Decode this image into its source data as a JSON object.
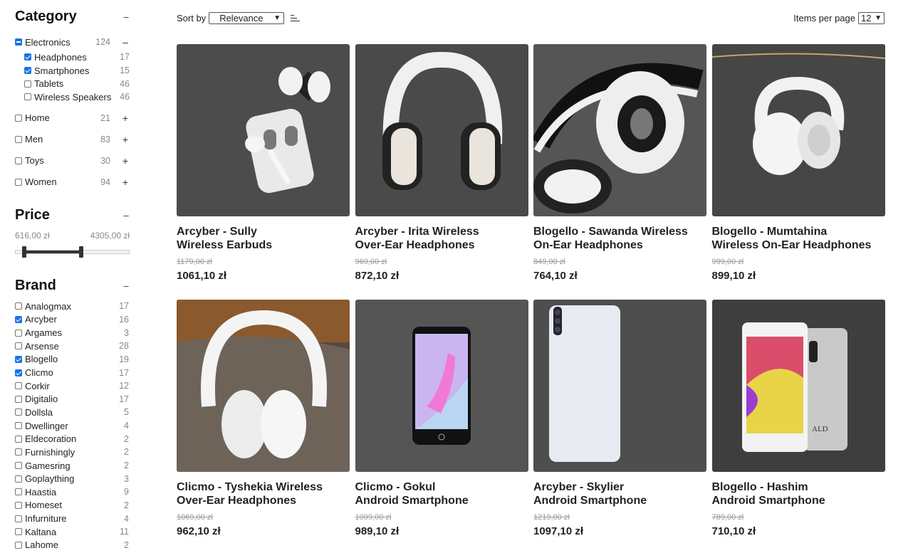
{
  "category": {
    "title": "Category",
    "collapse": "–",
    "parent": {
      "label": "Electronics",
      "count": "124",
      "toggle": "–"
    },
    "children": [
      {
        "label": "Headphones",
        "count": "17",
        "checked": true
      },
      {
        "label": "Smartphones",
        "count": "15",
        "checked": true
      },
      {
        "label": "Tablets",
        "count": "46",
        "checked": false
      },
      {
        "label": "Wireless Speakers",
        "count": "46",
        "checked": false
      }
    ],
    "others": [
      {
        "label": "Home",
        "count": "21",
        "toggle": "+"
      },
      {
        "label": "Men",
        "count": "83",
        "toggle": "+"
      },
      {
        "label": "Toys",
        "count": "30",
        "toggle": "+"
      },
      {
        "label": "Women",
        "count": "94",
        "toggle": "+"
      }
    ]
  },
  "price": {
    "title": "Price",
    "collapse": "–",
    "min_label": "616,00 zł",
    "max_label": "4305,00 zł"
  },
  "brand": {
    "title": "Brand",
    "collapse": "–",
    "items": [
      {
        "label": "Analogmax",
        "count": "17",
        "checked": false
      },
      {
        "label": "Arcyber",
        "count": "16",
        "checked": true
      },
      {
        "label": "Argames",
        "count": "3",
        "checked": false
      },
      {
        "label": "Arsense",
        "count": "28",
        "checked": false
      },
      {
        "label": "Blogello",
        "count": "19",
        "checked": true
      },
      {
        "label": "Clicmo",
        "count": "17",
        "checked": true
      },
      {
        "label": "Corkir",
        "count": "12",
        "checked": false
      },
      {
        "label": "Digitalio",
        "count": "17",
        "checked": false
      },
      {
        "label": "Dollsla",
        "count": "5",
        "checked": false
      },
      {
        "label": "Dwellinger",
        "count": "4",
        "checked": false
      },
      {
        "label": "Eldecoration",
        "count": "2",
        "checked": false
      },
      {
        "label": "Furnishingly",
        "count": "2",
        "checked": false
      },
      {
        "label": "Gamesring",
        "count": "2",
        "checked": false
      },
      {
        "label": "Goplaything",
        "count": "3",
        "checked": false
      },
      {
        "label": "Haastia",
        "count": "9",
        "checked": false
      },
      {
        "label": "Homeset",
        "count": "2",
        "checked": false
      },
      {
        "label": "Infurniture",
        "count": "4",
        "checked": false
      },
      {
        "label": "Kaltana",
        "count": "11",
        "checked": false
      },
      {
        "label": "Lahome",
        "count": "2",
        "checked": false
      }
    ]
  },
  "toolbar": {
    "sort_label": "Sort by",
    "sort_value": "Relevance",
    "ipp_label": "Items per page",
    "ipp_value": "12"
  },
  "products": [
    {
      "title": "Arcyber - Sully\nWireless Earbuds",
      "old_price": "1179,00 zł",
      "price": "1061,10 zł",
      "image": "earbuds"
    },
    {
      "title": "Arcyber - Irita Wireless\nOver-Ear Headphones",
      "old_price": "969,00 zł",
      "price": "872,10 zł",
      "image": "headphones-bw"
    },
    {
      "title": "Blogello - Sawanda Wireless\nOn-Ear Headphones",
      "old_price": "849,00 zł",
      "price": "764,10 zł",
      "image": "headphones-black"
    },
    {
      "title": "Blogello - Mumtahina\nWireless On-Ear Headphones",
      "old_price": "999,00 zł",
      "price": "899,10 zł",
      "image": "headphones-white"
    },
    {
      "title": "Clicmo - Tyshekia Wireless\nOver-Ear Headphones",
      "old_price": "1069,00 zł",
      "price": "962,10 zł",
      "image": "headphones-cloth"
    },
    {
      "title": "Clicmo - Gokul\nAndroid Smartphone",
      "old_price": "1099,00 zł",
      "price": "989,10 zł",
      "image": "phone-pink"
    },
    {
      "title": "Arcyber - Skylier\nAndroid Smartphone",
      "old_price": "1219,00 zł",
      "price": "1097,10 zł",
      "image": "phone-white"
    },
    {
      "title": "Blogello - Hashim\nAndroid Smartphone",
      "old_price": "789,00 zł",
      "price": "710,10 zł",
      "image": "phone-pair",
      "image_text": "ALD"
    }
  ],
  "colors": {
    "accent": "#1a73e8",
    "dark_bg": "#4a4a4a"
  }
}
